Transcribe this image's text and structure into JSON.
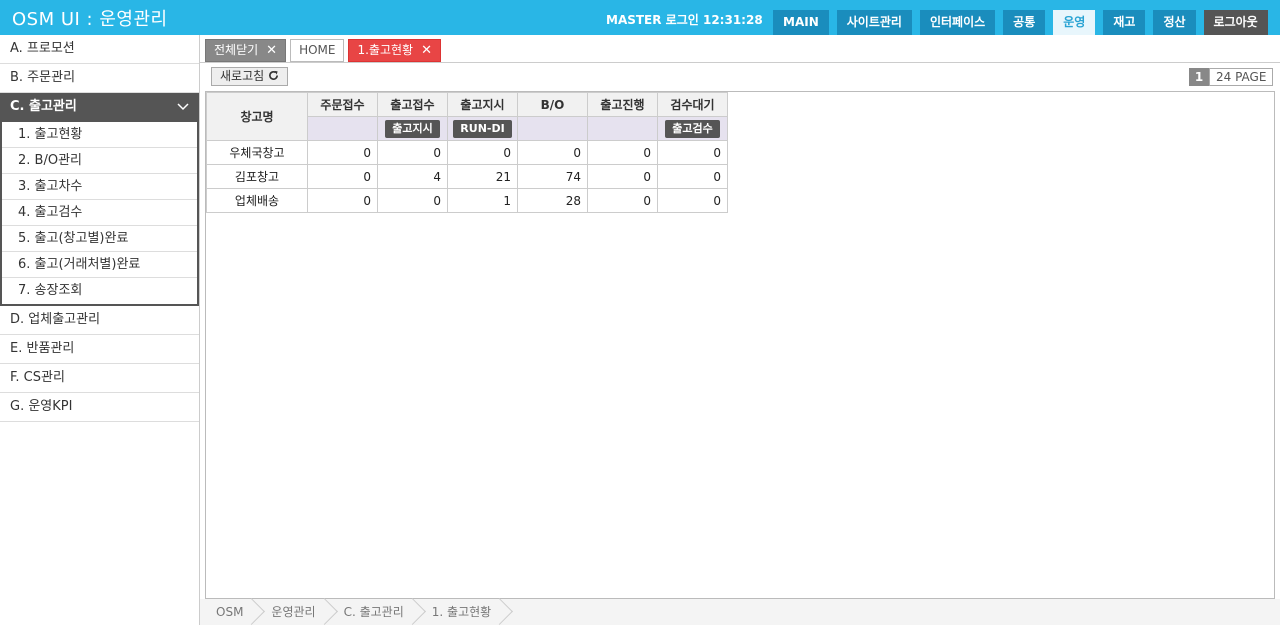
{
  "header": {
    "title": "OSM UI : 운영관리",
    "login": "MASTER 로그인 12:31:28",
    "nav": [
      "MAIN",
      "사이트관리",
      "인터페이스",
      "공통",
      "운영",
      "재고",
      "정산"
    ],
    "logout": "로그아웃"
  },
  "sidebar": {
    "items_before": [
      "A. 프로모션",
      "B. 주문관리"
    ],
    "open_item": "C. 출고관리",
    "sub_items": [
      "1. 출고현황",
      "2. B/O관리",
      "3. 출고차수",
      "4. 출고검수",
      "5. 출고(창고별)완료",
      "6. 출고(거래처별)완료",
      "7. 송장조회"
    ],
    "items_after": [
      "D. 업체출고관리",
      "E. 반품관리",
      "F. CS관리",
      "G. 운영KPI"
    ]
  },
  "tabs": {
    "close_all": "전체닫기",
    "home": "HOME",
    "current": "1.출고현황"
  },
  "toolbar": {
    "refresh": "새로고침",
    "page_current": "1",
    "page_total": "24 PAGE"
  },
  "grid": {
    "row_header": "창고명",
    "columns": [
      "주문접수",
      "출고접수",
      "출고지시",
      "B/O",
      "출고진행",
      "검수대기"
    ],
    "sub_buttons": [
      "",
      "출고지시",
      "RUN-DI",
      "",
      "",
      "출고검수"
    ],
    "rows": [
      {
        "name": "우체국창고",
        "values": [
          "0",
          "0",
          "0",
          "0",
          "0",
          "0"
        ]
      },
      {
        "name": "김포창고",
        "values": [
          "0",
          "4",
          "21",
          "74",
          "0",
          "0"
        ]
      },
      {
        "name": "업체배송",
        "values": [
          "0",
          "0",
          "1",
          "28",
          "0",
          "0"
        ]
      }
    ]
  },
  "breadcrumb": [
    "OSM",
    "운영관리",
    "C. 출고관리",
    "1. 출고현황"
  ]
}
